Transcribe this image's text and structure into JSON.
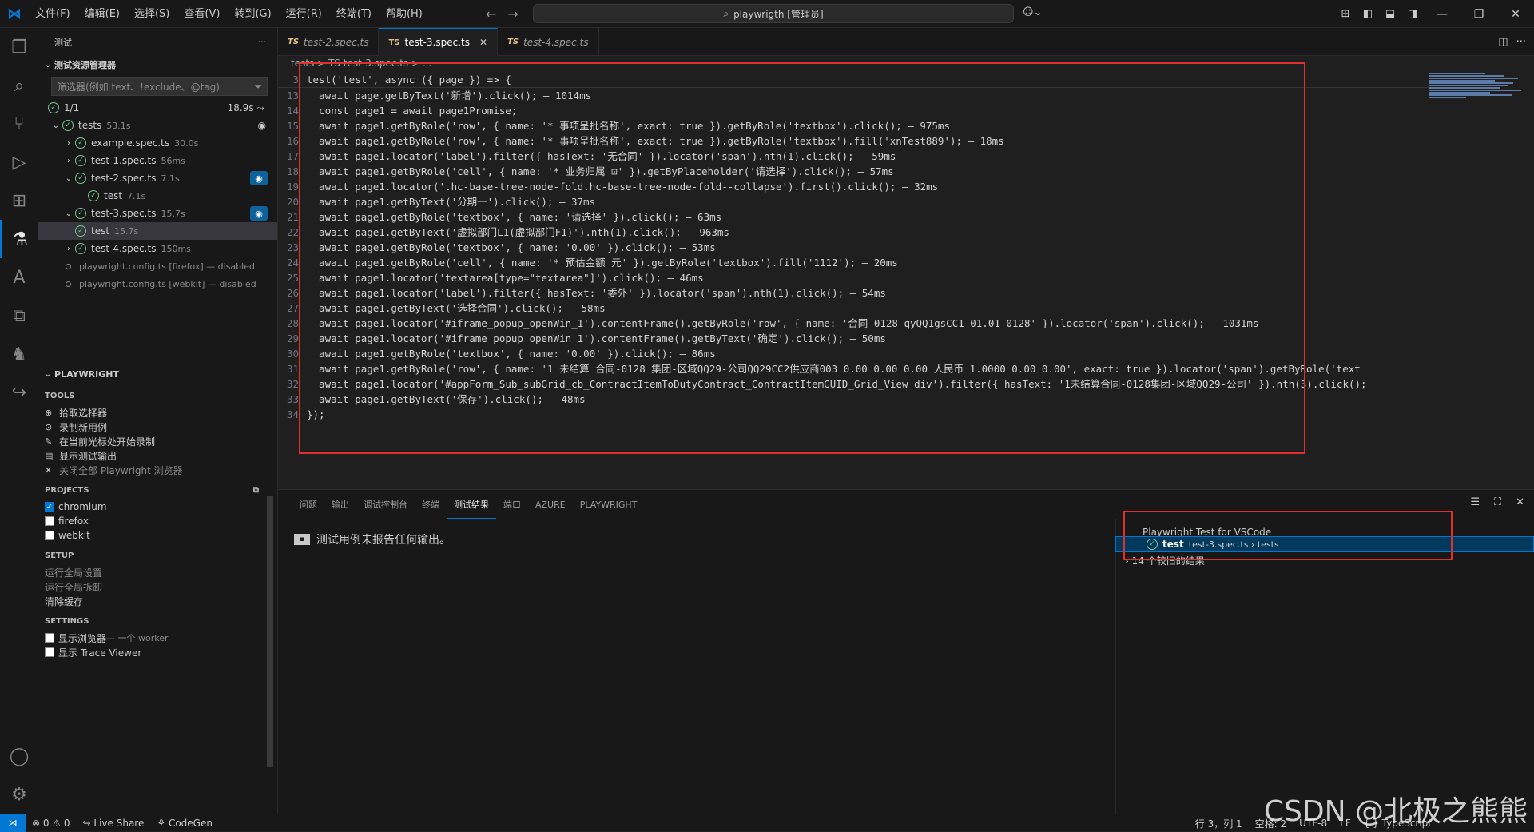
{
  "menu": [
    "文件(F)",
    "编辑(E)",
    "选择(S)",
    "查看(V)",
    "转到(G)",
    "运行(R)",
    "终端(T)",
    "帮助(H)"
  ],
  "search": "playwrigth [管理员]",
  "sidebar": {
    "title": "测试",
    "explorer_title": "测试资源管理器",
    "filter_placeholder": "筛选器(例如 text、!exclude、@tag)",
    "summary_count": "1/1",
    "summary_time": "18.9s",
    "tree": [
      {
        "label": "tests",
        "dur": "53.1s"
      },
      {
        "label": "example.spec.ts",
        "dur": "30.0s"
      },
      {
        "label": "test-1.spec.ts",
        "dur": "56ms"
      },
      {
        "label": "test-2.spec.ts",
        "dur": "7.1s"
      },
      {
        "label": "test",
        "dur": "7.1s"
      },
      {
        "label": "test-3.spec.ts",
        "dur": "15.7s"
      },
      {
        "label": "test",
        "dur": "15.7s"
      },
      {
        "label": "test-4.spec.ts",
        "dur": "150ms"
      },
      {
        "label": "playwright.config.ts [firefox] — disabled",
        "dur": ""
      },
      {
        "label": "playwright.config.ts [webkit] — disabled",
        "dur": ""
      }
    ],
    "playwright_title": "PLAYWRIGHT",
    "tools_title": "TOOLS",
    "tools": [
      "拾取选择器",
      "录制新用例",
      "在当前光标处开始录制",
      "显示测试输出",
      "关闭全部 Playwright 浏览器"
    ],
    "projects_title": "PROJECTS",
    "projects": [
      {
        "label": "chromium",
        "checked": true
      },
      {
        "label": "firefox",
        "checked": false
      },
      {
        "label": "webkit",
        "checked": false
      }
    ],
    "setup_title": "SETUP",
    "setup": [
      "运行全局设置",
      "运行全局拆卸",
      "清除缓存"
    ],
    "settings_title": "SETTINGS",
    "settings": [
      {
        "label": "显示浏览器",
        "extra": "— 一个 worker"
      },
      {
        "label": "显示 Trace Viewer",
        "extra": ""
      }
    ]
  },
  "tabs": [
    {
      "label": "test-2.spec.ts",
      "active": false
    },
    {
      "label": "test-3.spec.ts",
      "active": true
    },
    {
      "label": "test-4.spec.ts",
      "active": false
    }
  ],
  "breadcrumb": "tests  >  TS test-3.spec.ts  >  ...",
  "code_lines": [
    {
      "n": "3",
      "t": "test('test', async ({ page }) => {"
    },
    {
      "n": "13",
      "t": "  await page.getByText('新增').click(); — 1014ms"
    },
    {
      "n": "14",
      "t": "  const page1 = await page1Promise;"
    },
    {
      "n": "15",
      "t": "  await page1.getByRole('row', { name: '* 事项呈批名称', exact: true }).getByRole('textbox').click(); — 975ms"
    },
    {
      "n": "16",
      "t": "  await page1.getByRole('row', { name: '* 事项呈批名称', exact: true }).getByRole('textbox').fill('xnTest889'); — 18ms"
    },
    {
      "n": "17",
      "t": "  await page1.locator('label').filter({ hasText: '无合同' }).locator('span').nth(1).click(); — 59ms"
    },
    {
      "n": "18",
      "t": "  await page1.getByRole('cell', { name: '* 业务归属 ⊡' }).getByPlaceholder('请选择').click(); — 57ms"
    },
    {
      "n": "19",
      "t": "  await page1.locator('.hc-base-tree-node-fold.hc-base-tree-node-fold--collapse').first().click(); — 32ms"
    },
    {
      "n": "20",
      "t": "  await page1.getByText('分期一').click(); — 37ms"
    },
    {
      "n": "21",
      "t": "  await page1.getByRole('textbox', { name: '请选择' }).click(); — 63ms"
    },
    {
      "n": "22",
      "t": "  await page1.getByText('虚拟部门L1(虚拟部门F1)').nth(1).click(); — 963ms"
    },
    {
      "n": "23",
      "t": "  await page1.getByRole('textbox', { name: '0.00' }).click(); — 53ms"
    },
    {
      "n": "24",
      "t": "  await page1.getByRole('cell', { name: '* 预估金额 元' }).getByRole('textbox').fill('1112'); — 20ms"
    },
    {
      "n": "25",
      "t": "  await page1.locator('textarea[type=\"textarea\"]').click(); — 46ms"
    },
    {
      "n": "26",
      "t": "  await page1.locator('label').filter({ hasText: '委外' }).locator('span').nth(1).click(); — 54ms"
    },
    {
      "n": "27",
      "t": "  await page1.getByText('选择合同').click(); — 58ms"
    },
    {
      "n": "28",
      "t": "  await page1.locator('#iframe_popup_openWin_1').contentFrame().getByRole('row', { name: '合同-0128 qyQQ1gsCC1-01.01-0128' }).locator('span').click(); — 1031ms"
    },
    {
      "n": "29",
      "t": "  await page1.locator('#iframe_popup_openWin_1').contentFrame().getByText('确定').click(); — 50ms"
    },
    {
      "n": "30",
      "t": "  await page1.getByRole('textbox', { name: '0.00' }).click(); — 86ms"
    },
    {
      "n": "31",
      "t": "  await page1.getByRole('row', { name: '1 未结算 合同-0128 集团-区域QQ29-公司QQ29CC2供应商003 0.00 0.00 0.00 人民币 1.0000 0.00 0.00', exact: true }).locator('span').getByRole('text"
    },
    {
      "n": "32",
      "t": "  await page1.locator('#appForm_Sub_subGrid_cb_ContractItemToDutyContract_ContractItemGUID_Grid_View div').filter({ hasText: '1未结算合同-0128集团-区域QQ29-公司' }).nth(3).click();"
    },
    {
      "n": "33",
      "t": "  await page1.getByText('保存').click(); — 48ms"
    },
    {
      "n": "34",
      "t": "});"
    }
  ],
  "panel": {
    "tabs": [
      "问题",
      "输出",
      "调试控制台",
      "终端",
      "测试结果",
      "端口",
      "AZURE",
      "PLAYWRIGHT"
    ],
    "active_tab": "测试结果",
    "message": "测试用例未报告任何输出。",
    "results_title": "Playwright Test for VSCode",
    "result_name": "test",
    "result_path": "test-3.spec.ts › tests",
    "older_results": "14 个较旧的结果"
  },
  "status": {
    "errors": "⊗ 0 ⚠ 0",
    "liveshare": "Live Share",
    "codegen": "CodeGen",
    "position": "行 3，列 1",
    "spaces": "空格: 2",
    "encoding": "UTF-8",
    "eol": "LF",
    "language": "{ } TypeScript"
  },
  "watermark": "CSDN @北极之熊熊",
  "colors": {
    "accent": "#0078d4",
    "pass": "#73c991",
    "highlight_box": "#e03030"
  }
}
